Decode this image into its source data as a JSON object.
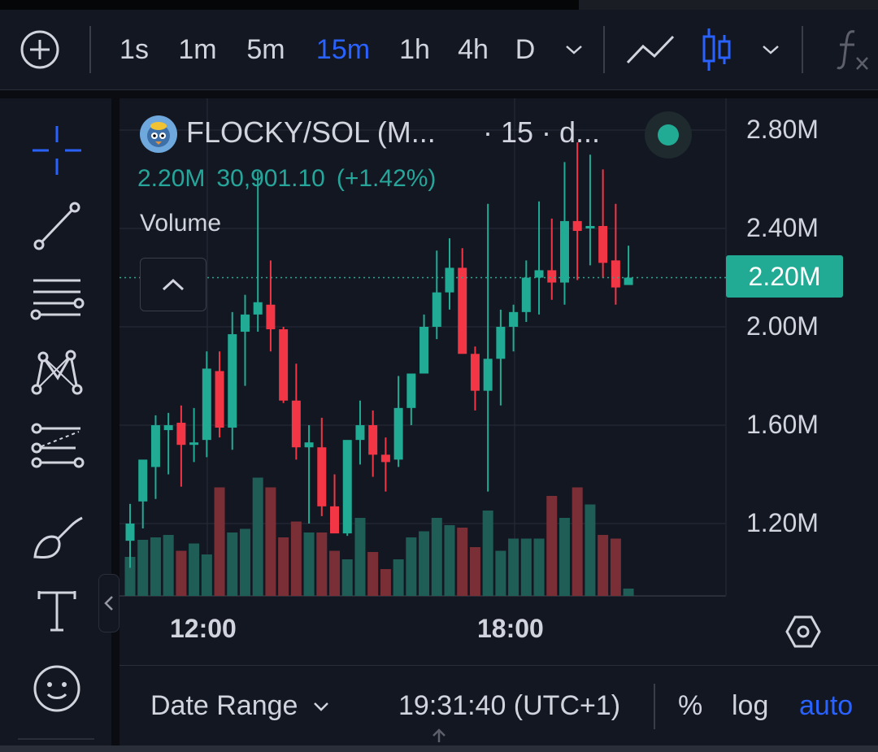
{
  "toolbar": {
    "timeframes": [
      "1s",
      "1m",
      "5m",
      "15m",
      "1h",
      "4h",
      "D"
    ],
    "active_timeframe": "15m"
  },
  "legend": {
    "title": "FLOCKY/SOL (M...",
    "suffix": "· 15 · d...",
    "value": "2.20M",
    "volume": "30,901.10",
    "change": "(+1.42%)",
    "volume_label": "Volume"
  },
  "price_tag": "2.20M",
  "bottom_bar": {
    "date_range": "Date Range",
    "time": "19:31:40 (UTC+1)",
    "percent": "%",
    "log": "log",
    "auto": "auto"
  },
  "colors": {
    "up": "#22ab94",
    "down": "#f23645",
    "up_volume": "#1e5e56",
    "down_volume": "#7a2e36",
    "accent": "#2962ff",
    "background": "#131722"
  },
  "chart_data": {
    "type": "candlestick",
    "y_ticks": [
      "2.80M",
      "2.40M",
      "2.00M",
      "1.60M",
      "1.20M"
    ],
    "y_tick_values": [
      2.8,
      2.4,
      2.0,
      1.6,
      1.2
    ],
    "x_ticks": [
      "12:00",
      "18:00"
    ],
    "ylim": [
      0.93,
      2.95
    ],
    "last_price": 2.2,
    "grid": true,
    "candles": [
      {
        "o": 1.13,
        "h": 1.28,
        "l": 1.02,
        "c": 1.2,
        "v": 0.32
      },
      {
        "o": 1.29,
        "h": 1.45,
        "l": 1.18,
        "c": 1.46,
        "v": 0.46
      },
      {
        "o": 1.43,
        "h": 1.64,
        "l": 1.3,
        "c": 1.6,
        "v": 0.48
      },
      {
        "o": 1.58,
        "h": 1.65,
        "l": 1.4,
        "c": 1.6,
        "v": 0.5
      },
      {
        "o": 1.61,
        "h": 1.68,
        "l": 1.35,
        "c": 1.52,
        "v": 0.37
      },
      {
        "o": 1.52,
        "h": 1.67,
        "l": 1.45,
        "c": 1.53,
        "v": 0.43
      },
      {
        "o": 1.54,
        "h": 1.9,
        "l": 1.47,
        "c": 1.83,
        "v": 0.34
      },
      {
        "o": 1.82,
        "h": 1.9,
        "l": 1.55,
        "c": 1.59,
        "v": 0.89
      },
      {
        "o": 1.59,
        "h": 2.06,
        "l": 1.5,
        "c": 1.97,
        "v": 0.52
      },
      {
        "o": 1.98,
        "h": 2.13,
        "l": 1.76,
        "c": 2.05,
        "v": 0.55
      },
      {
        "o": 2.05,
        "h": 2.63,
        "l": 1.98,
        "c": 2.1,
        "v": 0.97
      },
      {
        "o": 2.09,
        "h": 2.27,
        "l": 1.9,
        "c": 1.99,
        "v": 0.89
      },
      {
        "o": 1.99,
        "h": 2.0,
        "l": 1.69,
        "c": 1.7,
        "v": 0.48
      },
      {
        "o": 1.7,
        "h": 1.85,
        "l": 1.46,
        "c": 1.51,
        "v": 0.61
      },
      {
        "o": 1.51,
        "h": 1.6,
        "l": 1.2,
        "c": 1.53,
        "v": 0.52
      },
      {
        "o": 1.51,
        "h": 1.63,
        "l": 1.23,
        "c": 1.27,
        "v": 0.52
      },
      {
        "o": 1.27,
        "h": 1.4,
        "l": 1.17,
        "c": 1.16,
        "v": 0.37
      },
      {
        "o": 1.16,
        "h": 1.4,
        "l": 1.15,
        "c": 1.54,
        "v": 0.3
      },
      {
        "o": 1.54,
        "h": 1.7,
        "l": 1.44,
        "c": 1.6,
        "v": 0.64
      },
      {
        "o": 1.6,
        "h": 1.66,
        "l": 1.39,
        "c": 1.48,
        "v": 0.36
      },
      {
        "o": 1.48,
        "h": 1.55,
        "l": 1.33,
        "c": 1.45,
        "v": 0.22
      },
      {
        "o": 1.46,
        "h": 1.8,
        "l": 1.43,
        "c": 1.67,
        "v": 0.3
      },
      {
        "o": 1.67,
        "h": 1.8,
        "l": 1.6,
        "c": 1.81,
        "v": 0.48
      },
      {
        "o": 1.81,
        "h": 2.05,
        "l": 1.82,
        "c": 2.0,
        "v": 0.53
      },
      {
        "o": 2.0,
        "h": 2.31,
        "l": 1.95,
        "c": 2.14,
        "v": 0.64
      },
      {
        "o": 2.14,
        "h": 2.36,
        "l": 2.07,
        "c": 2.24,
        "v": 0.58
      },
      {
        "o": 2.24,
        "h": 2.32,
        "l": 1.92,
        "c": 1.89,
        "v": 0.56
      },
      {
        "o": 1.89,
        "h": 1.92,
        "l": 1.66,
        "c": 1.74,
        "v": 0.4
      },
      {
        "o": 1.74,
        "h": 2.5,
        "l": 1.33,
        "c": 1.87,
        "v": 0.7
      },
      {
        "o": 1.87,
        "h": 2.07,
        "l": 1.68,
        "c": 2.0,
        "v": 0.37
      },
      {
        "o": 2.0,
        "h": 2.09,
        "l": 1.9,
        "c": 2.06,
        "v": 0.47
      },
      {
        "o": 2.06,
        "h": 2.27,
        "l": 2.02,
        "c": 2.2,
        "v": 0.47
      },
      {
        "o": 2.2,
        "h": 2.51,
        "l": 2.05,
        "c": 2.23,
        "v": 0.47
      },
      {
        "o": 2.23,
        "h": 2.44,
        "l": 2.11,
        "c": 2.18,
        "v": 0.82
      },
      {
        "o": 2.18,
        "h": 2.67,
        "l": 2.09,
        "c": 2.43,
        "v": 0.64
      },
      {
        "o": 2.43,
        "h": 2.75,
        "l": 2.19,
        "c": 2.39,
        "v": 0.89
      },
      {
        "o": 2.4,
        "h": 2.7,
        "l": 2.25,
        "c": 2.41,
        "v": 0.75
      },
      {
        "o": 2.41,
        "h": 2.64,
        "l": 2.2,
        "c": 2.26,
        "v": 0.5
      },
      {
        "o": 2.27,
        "h": 2.5,
        "l": 2.09,
        "c": 2.16,
        "v": 0.47
      },
      {
        "o": 2.17,
        "h": 2.33,
        "l": 2.18,
        "c": 2.2,
        "v": 0.06
      }
    ]
  }
}
